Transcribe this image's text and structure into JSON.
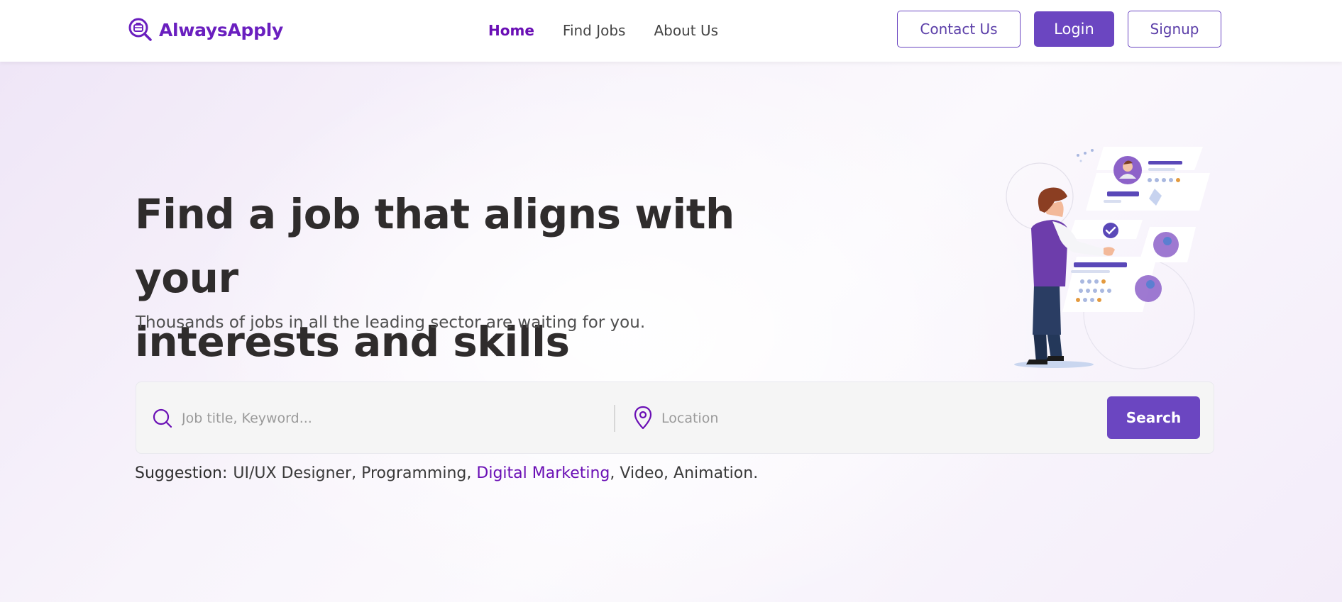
{
  "brand": {
    "name": "AlwaysApply",
    "logo_icon": "briefcase-magnifier-icon",
    "color": "#6a1fbf"
  },
  "nav": {
    "links": [
      {
        "label": "Home",
        "active": true
      },
      {
        "label": "Find Jobs",
        "active": false
      },
      {
        "label": "About Us",
        "active": false
      }
    ],
    "contact_label": "Contact Us",
    "login_label": "Login",
    "signup_label": "Signup"
  },
  "hero": {
    "title_line1": "Find a job that aligns with your",
    "title_line2": "interests and skills",
    "subtitle": "Thousands of jobs in all the leading sector are waiting for you.",
    "illustration": "person-browsing-profiles-illustration"
  },
  "search": {
    "keyword_placeholder": "Job title, Keyword...",
    "keyword_value": "",
    "location_placeholder": "Location",
    "location_value": "",
    "button_label": "Search",
    "keyword_icon": "search-icon",
    "location_icon": "map-pin-icon"
  },
  "suggestions": {
    "label": "Suggestion:",
    "items": [
      "UI/UX Designer",
      "Programming",
      "Digital Marketing",
      "Video",
      "Animation"
    ],
    "highlighted": "Digital Marketing",
    "end": "."
  },
  "colors": {
    "accent": "#6b46c1",
    "active_link": "#6a0fb5",
    "title_text": "#2f2c2c"
  }
}
